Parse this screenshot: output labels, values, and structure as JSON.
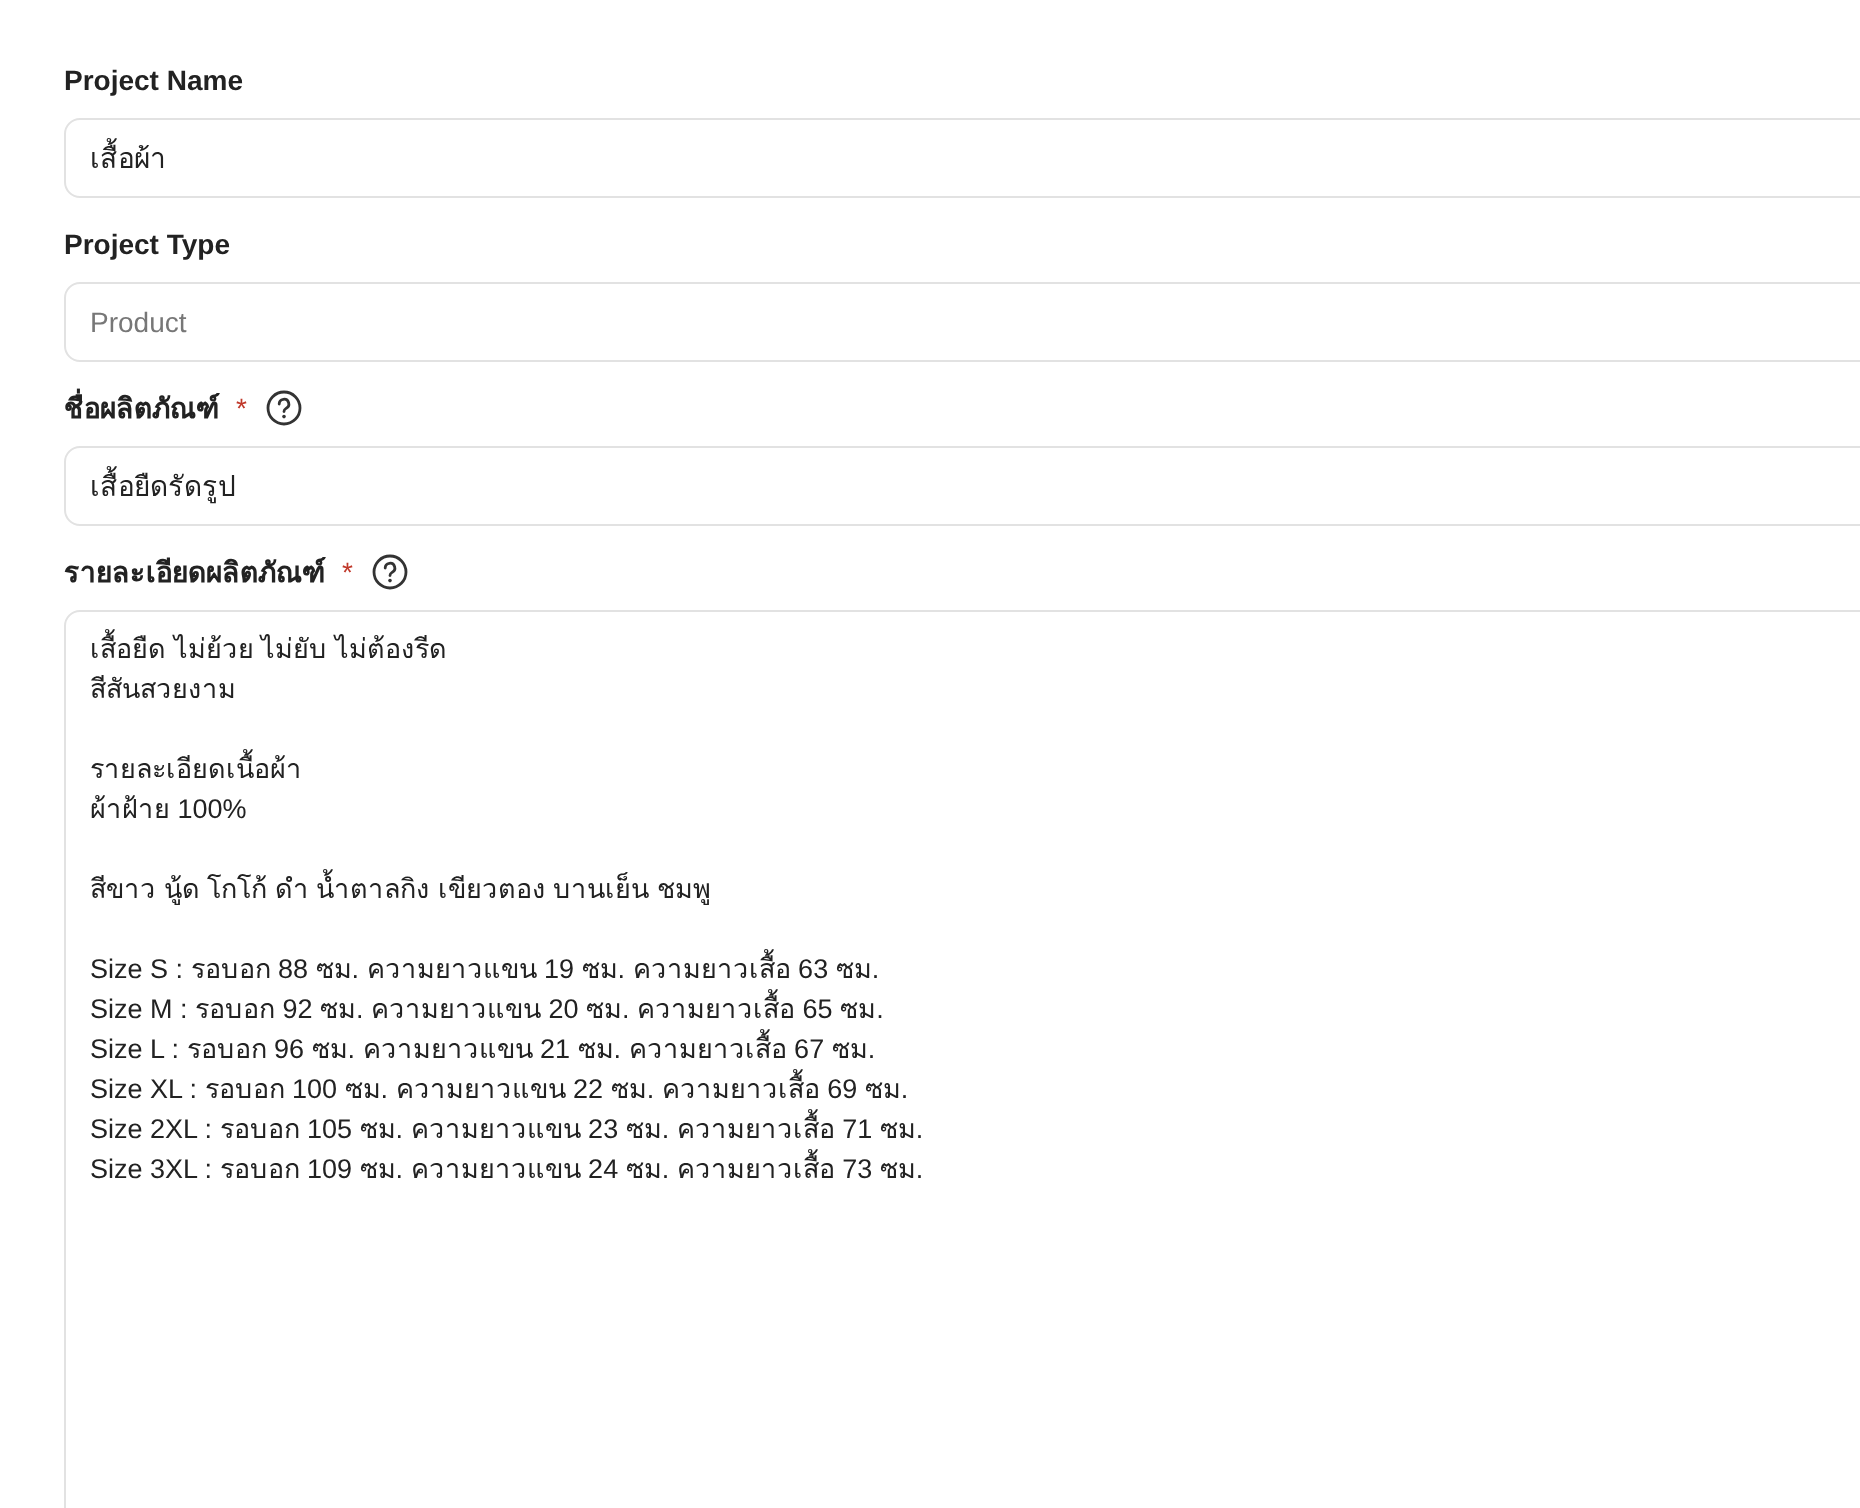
{
  "fields": [
    {
      "kind": "input",
      "label": "Project Name",
      "value": "เสื้อผ้า"
    },
    {
      "kind": "input",
      "label": "Project Type",
      "placeholder": "Product"
    },
    {
      "kind": "input",
      "label": "ชื่อผลิตภัณฑ์",
      "required_mark": "*",
      "help": true,
      "value": "เสื้อยืดรัดรูป"
    },
    {
      "kind": "textarea",
      "label": "รายละเอียดผลิตภัณฑ์",
      "required_mark": "*",
      "help": true,
      "paragraphs": [
        [
          "เสื้อยืด ไม่ย้วย ไม่ยับ ไม่ต้องรีด",
          "สีสันสวยงาม"
        ],
        [
          "รายละเอียดเนื้อผ้า",
          "ผ้าฝ้าย 100%"
        ],
        [
          "สีขาว นู้ด โกโก้ ดำ น้ำตาลกิง เขียวตอง บานเย็น ชมพู"
        ],
        [
          "Size S : รอบอก 88 ซม. ความยาวแขน 19 ซม. ความยาวเสื้อ 63 ซม.",
          "Size M : รอบอก 92 ซม. ความยาวแขน 20 ซม. ความยาวเสื้อ 65 ซม.",
          "Size L : รอบอก 96 ซม. ความยาวแขน 21 ซม. ความยาวเสื้อ 67 ซม.",
          "Size XL : รอบอก 100 ซม. ความยาวแขน 22 ซม. ความยาวเสื้อ 69 ซม.",
          "Size 2XL : รอบอก 105 ซม. ความยาวแขน 23 ซม. ความยาวเสื้อ 71 ซม.",
          "Size 3XL : รอบอก 109 ซม. ความยาวแขน 24 ซม. ความยาวเสื้อ 73 ซม."
        ]
      ]
    }
  ]
}
